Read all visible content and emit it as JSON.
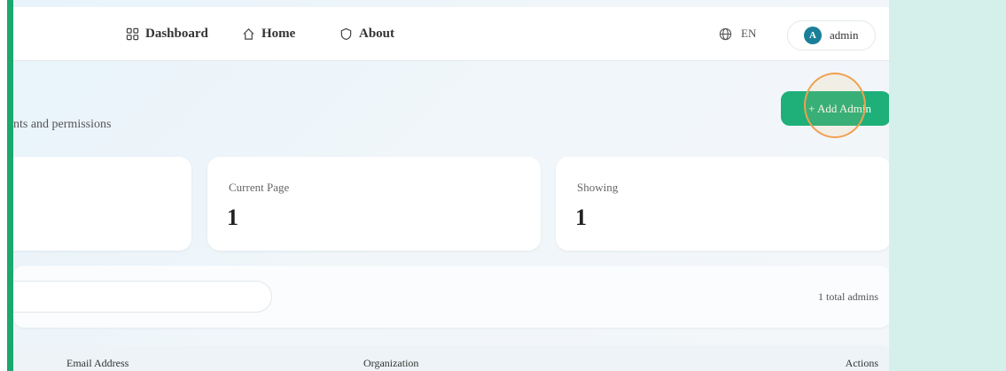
{
  "nav": {
    "items": [
      {
        "label": "Dashboard",
        "icon": "dashboard-grid-icon"
      },
      {
        "label": "Home",
        "icon": "home-icon"
      },
      {
        "label": "About",
        "icon": "about-shield-icon"
      }
    ],
    "language": "EN",
    "user": {
      "initial": "A",
      "name": "admin"
    }
  },
  "page": {
    "subtitle": "nts and permissions",
    "add_button_label": "+ Add Admin"
  },
  "stats": [
    {
      "label": "",
      "value": ""
    },
    {
      "label": "Current Page",
      "value": "1"
    },
    {
      "label": "Showing",
      "value": "1"
    }
  ],
  "search": {
    "placeholder": "",
    "total_text": "1 total admins"
  },
  "table": {
    "columns": [
      "Email Address",
      "Organization",
      "Actions"
    ]
  },
  "colors": {
    "accent": "#1aa86f",
    "button": "#1fb07a",
    "avatar": "#1a7f99",
    "highlight_ring": "#f0a050",
    "side_panel": "#d5f0eb"
  }
}
